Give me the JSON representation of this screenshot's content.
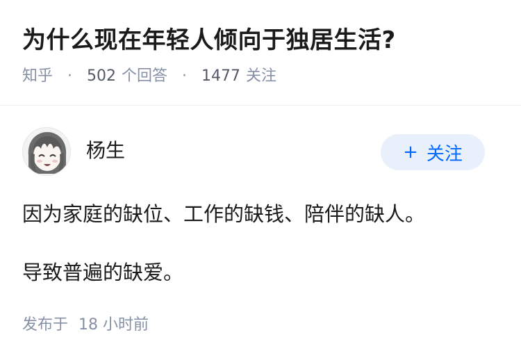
{
  "question": {
    "title": "为什么现在年轻人倾向于独居生活?",
    "source": "知乎",
    "separator": "·",
    "answer_count": "502",
    "answer_label": "个回答",
    "follower_count": "1477",
    "follower_label": "关注"
  },
  "answer": {
    "author": {
      "name": "杨生",
      "avatar_icon": "anime-girl-avatar"
    },
    "follow_button": {
      "icon": "+",
      "label": "关注"
    },
    "paragraphs": [
      "因为家庭的缺位、工作的缺钱、陪伴的缺人。",
      "导致普遍的缺爱。"
    ],
    "publish_label": "发布于",
    "publish_time": "18 小时前"
  },
  "colors": {
    "title": "#1a1a1a",
    "meta": "#8590a6",
    "accent": "#0066ff",
    "follow_bg": "#e8f0fb"
  }
}
